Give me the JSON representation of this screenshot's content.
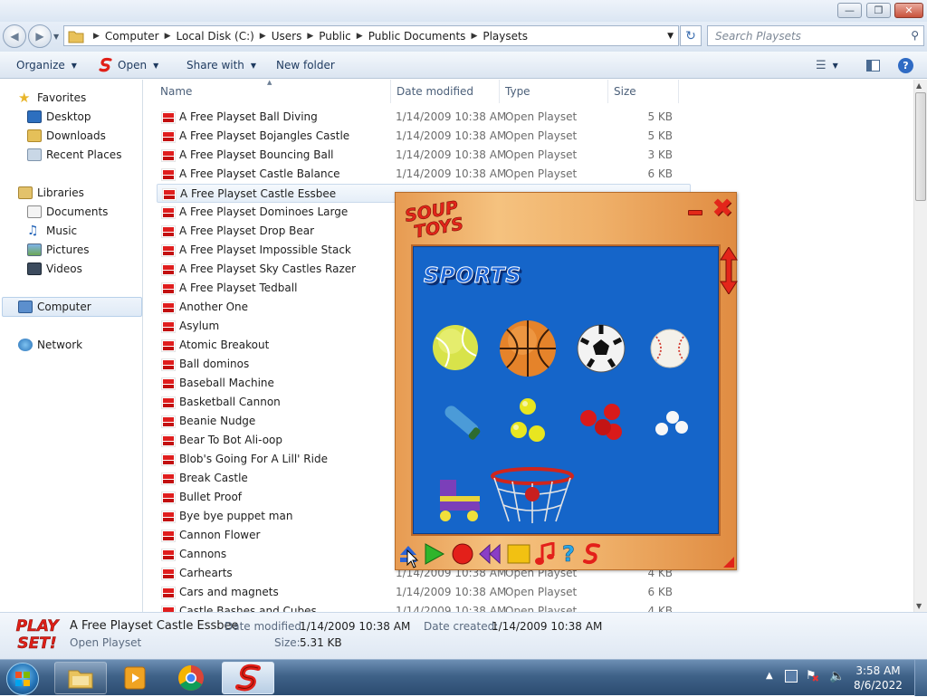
{
  "explorer": {
    "address_crumbs": [
      "Computer",
      "Local Disk (C:)",
      "Users",
      "Public",
      "Public Documents",
      "Playsets"
    ],
    "search_placeholder": "Search Playsets",
    "toolbar": {
      "organize": "Organize",
      "open": "Open",
      "share_with": "Share with",
      "new_folder": "New folder"
    },
    "nav": {
      "favorites": "Favorites",
      "desktop": "Desktop",
      "downloads": "Downloads",
      "recent_places": "Recent Places",
      "libraries": "Libraries",
      "documents": "Documents",
      "music": "Music",
      "pictures": "Pictures",
      "videos": "Videos",
      "computer": "Computer",
      "network": "Network"
    },
    "columns": {
      "name": "Name",
      "date_modified": "Date modified",
      "type": "Type",
      "size": "Size"
    },
    "files": [
      {
        "name": "A Free Playset Ball Diving",
        "date": "1/14/2009 10:38 AM",
        "type": "Open Playset",
        "size": "5 KB"
      },
      {
        "name": "A Free Playset Bojangles Castle",
        "date": "1/14/2009 10:38 AM",
        "type": "Open Playset",
        "size": "5 KB"
      },
      {
        "name": "A Free Playset Bouncing Ball",
        "date": "1/14/2009 10:38 AM",
        "type": "Open Playset",
        "size": "3 KB"
      },
      {
        "name": "A Free Playset Castle Balance",
        "date": "1/14/2009 10:38 AM",
        "type": "Open Playset",
        "size": "6 KB"
      },
      {
        "name": "A Free Playset Castle Essbee",
        "date": "",
        "type": "",
        "size": ""
      },
      {
        "name": "A Free Playset Dominoes Large",
        "date": "",
        "type": "",
        "size": ""
      },
      {
        "name": "A Free Playset Drop Bear",
        "date": "",
        "type": "",
        "size": ""
      },
      {
        "name": "A Free Playset Impossible Stack",
        "date": "",
        "type": "",
        "size": ""
      },
      {
        "name": "A Free Playset Sky Castles Razer",
        "date": "",
        "type": "",
        "size": ""
      },
      {
        "name": "A Free Playset Tedball",
        "date": "",
        "type": "",
        "size": ""
      },
      {
        "name": "Another One",
        "date": "",
        "type": "",
        "size": ""
      },
      {
        "name": "Asylum",
        "date": "",
        "type": "",
        "size": ""
      },
      {
        "name": "Atomic Breakout",
        "date": "",
        "type": "",
        "size": ""
      },
      {
        "name": "Ball dominos",
        "date": "",
        "type": "",
        "size": ""
      },
      {
        "name": "Baseball Machine",
        "date": "",
        "type": "",
        "size": ""
      },
      {
        "name": "Basketball Cannon",
        "date": "",
        "type": "",
        "size": ""
      },
      {
        "name": "Beanie Nudge",
        "date": "",
        "type": "",
        "size": ""
      },
      {
        "name": "Bear To Bot Ali-oop",
        "date": "",
        "type": "",
        "size": ""
      },
      {
        "name": "Blob's Going For A Lill' Ride",
        "date": "",
        "type": "",
        "size": ""
      },
      {
        "name": "Break Castle",
        "date": "",
        "type": "",
        "size": ""
      },
      {
        "name": "Bullet Proof",
        "date": "",
        "type": "",
        "size": ""
      },
      {
        "name": "Bye bye puppet man",
        "date": "",
        "type": "",
        "size": ""
      },
      {
        "name": "Cannon Flower",
        "date": "",
        "type": "",
        "size": ""
      },
      {
        "name": "Cannons",
        "date": "",
        "type": "",
        "size": ""
      },
      {
        "name": "Carhearts",
        "date": "1/14/2009 10:38 AM",
        "type": "Open Playset",
        "size": "4 KB"
      },
      {
        "name": "Cars and magnets",
        "date": "1/14/2009 10:38 AM",
        "type": "Open Playset",
        "size": "6 KB"
      },
      {
        "name": "Castle Bashes and Cubes",
        "date": "1/14/2009 10:38 AM",
        "type": "Open Playset",
        "size": "4 KB"
      }
    ],
    "details": {
      "name": "A Free Playset Castle Essbee",
      "type": "Open Playset",
      "date_modified_label": "Date modified:",
      "date_modified": "1/14/2009 10:38 AM",
      "date_created_label": "Date created:",
      "date_created": "1/14/2009 10:38 AM",
      "size_label": "Size:",
      "size": "5.31 KB",
      "logo_top": "PLAY",
      "logo_bottom": "SET!"
    }
  },
  "soup": {
    "logo_top": "SOUP",
    "logo_bottom": "TOYS",
    "category": "SPORTS",
    "colors": {
      "stage": "#1565c9",
      "frame": "#f0b56d",
      "accent": "#e3251a"
    }
  },
  "taskbar": {
    "time": "3:58 AM",
    "date": "8/6/2022"
  }
}
